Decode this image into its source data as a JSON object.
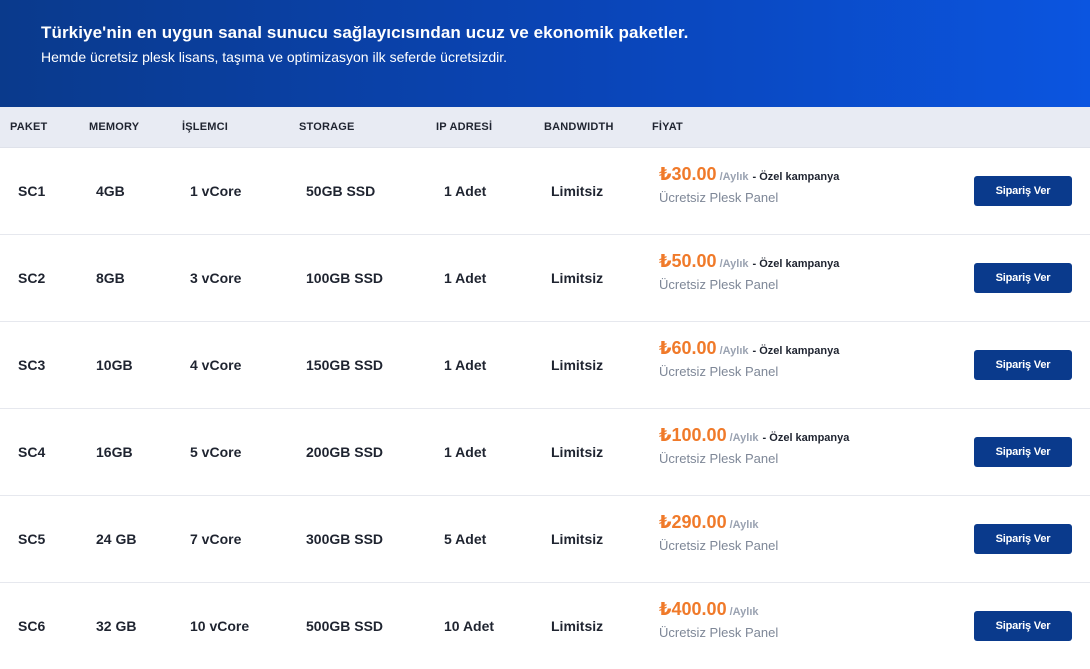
{
  "hero": {
    "title": "Türkiye'nin en uygun sanal sunucu sağlayıcısından ucuz ve ekonomik paketler.",
    "subtitle": "Hemde ücretsiz plesk lisans, taşıma ve optimizasyon ilk seferde ücretsizdir."
  },
  "table": {
    "headers": [
      "PAKET",
      "MEMORY",
      "İŞLEMCI",
      "STORAGE",
      "IP ADRESİ",
      "BANDWIDTH",
      "FİYAT"
    ],
    "rows": [
      {
        "paket": "SC1",
        "memory": "4GB",
        "cpu": "1 vCore",
        "storage": "50GB SSD",
        "ip": "1 Adet",
        "bandwidth": "Limitsiz",
        "price": "₺30.00",
        "period": "/Aylık",
        "campaign": "- Özel kampanya",
        "plesk": "Ücretsiz Plesk Panel",
        "button": "Sipariş Ver"
      },
      {
        "paket": "SC2",
        "memory": "8GB",
        "cpu": "3 vCore",
        "storage": "100GB SSD",
        "ip": "1 Adet",
        "bandwidth": "Limitsiz",
        "price": "₺50.00",
        "period": "/Aylık",
        "campaign": "- Özel kampanya",
        "plesk": "Ücretsiz Plesk Panel",
        "button": "Sipariş Ver"
      },
      {
        "paket": "SC3",
        "memory": "10GB",
        "cpu": "4 vCore",
        "storage": "150GB SSD",
        "ip": "1 Adet",
        "bandwidth": "Limitsiz",
        "price": "₺60.00",
        "period": "/Aylık",
        "campaign": "- Özel kampanya",
        "plesk": "Ücretsiz Plesk Panel",
        "button": "Sipariş Ver"
      },
      {
        "paket": "SC4",
        "memory": "16GB",
        "cpu": "5 vCore",
        "storage": "200GB SSD",
        "ip": "1 Adet",
        "bandwidth": "Limitsiz",
        "price": "₺100.00",
        "period": "/Aylık",
        "campaign": "- Özel kampanya",
        "plesk": "Ücretsiz Plesk Panel",
        "button": "Sipariş Ver"
      },
      {
        "paket": "SC5",
        "memory": "24 GB",
        "cpu": "7 vCore",
        "storage": "300GB SSD",
        "ip": "5 Adet",
        "bandwidth": "Limitsiz",
        "price": "₺290.00",
        "period": "/Aylık",
        "campaign": "",
        "plesk": "Ücretsiz Plesk Panel",
        "button": "Sipariş Ver"
      },
      {
        "paket": "SC6",
        "memory": "32 GB",
        "cpu": "10 vCore",
        "storage": "500GB SSD",
        "ip": "10 Adet",
        "bandwidth": "Limitsiz",
        "price": "₺400.00",
        "period": "/Aylık",
        "campaign": "",
        "plesk": "Ücretsiz Plesk Panel",
        "button": "Sipariş Ver"
      }
    ]
  },
  "colors": {
    "hero_start": "#0a3a8c",
    "hero_end": "#0b55e0",
    "price": "#f07a2a",
    "button": "#0a3a8c"
  }
}
